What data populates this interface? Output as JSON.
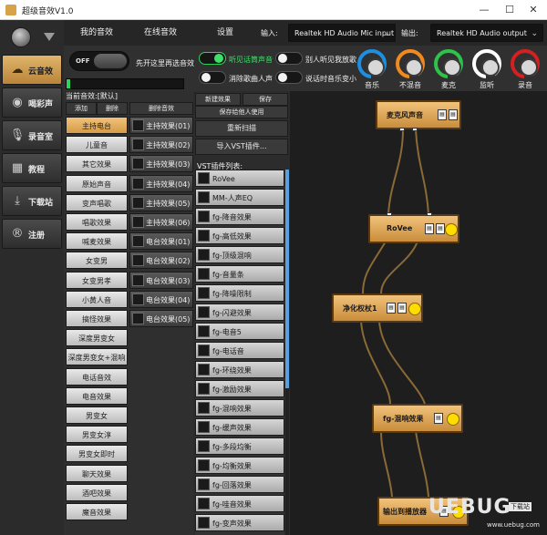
{
  "titlebar": {
    "title": "超级音效V1.0",
    "min": "—",
    "max": "☐",
    "close": "✕"
  },
  "nav": {
    "items": [
      {
        "label": "云音效",
        "icon": "☁",
        "active": true
      },
      {
        "label": "喝彩声",
        "icon": "◉",
        "active": false
      },
      {
        "label": "录音室",
        "icon": "🎙",
        "active": false
      },
      {
        "label": "教程",
        "icon": "▦",
        "active": false
      },
      {
        "label": "下载站",
        "icon": "⤓",
        "active": false
      },
      {
        "label": "注册",
        "icon": "®",
        "active": false
      }
    ]
  },
  "tabs": [
    "我的音效",
    "在线音效",
    "设置"
  ],
  "devices": {
    "input_label": "输入:",
    "input_value": "Realtek HD Audio Mic input",
    "output_label": "输出:",
    "output_value": "Realtek HD Audio output"
  },
  "options": {
    "power_label": "OFF",
    "hint": "先开这里再选音效",
    "toggles": [
      {
        "label": "听见话筒声音",
        "on": true
      },
      {
        "label": "别人听见我放歌",
        "on": false
      },
      {
        "label": "消除歌曲人声",
        "on": false
      },
      {
        "label": "说话时音乐变小",
        "on": false
      }
    ],
    "knobs": [
      {
        "label": "音乐",
        "color": "#1e8fe0"
      },
      {
        "label": "不混音",
        "color": "#f08a1e"
      },
      {
        "label": "麦克",
        "color": "#2ec24a"
      },
      {
        "label": "监听",
        "color": "#ffffff"
      },
      {
        "label": "录音",
        "color": "#d42020"
      }
    ],
    "level": 0.03
  },
  "presets": {
    "header": "当前音效:[默认]",
    "add": "添加",
    "delete": "删除",
    "delete_effect": "删除音效",
    "items": [
      "主持电台",
      "儿童音",
      "其它效果",
      "原始声音",
      "变声唱歌",
      "唱歌效果",
      "喊麦效果",
      "女变男",
      "女变男孝",
      "小黄人音",
      "搞怪效果",
      "深度男变女",
      "深度男变女+混响",
      "电话音效",
      "电音效果",
      "男变女",
      "男变女淳",
      "男变女即时",
      "聊天效果",
      "酒吧效果",
      "魔音效果"
    ],
    "selected": 0
  },
  "effects": {
    "items": [
      "主持效果(01)",
      "主持效果(02)",
      "主持效果(03)",
      "主持效果(04)",
      "主持效果(05)",
      "主持效果(06)",
      "电台效果(01)",
      "电台效果(02)",
      "电台效果(03)",
      "电台效果(04)",
      "电台效果(05)"
    ]
  },
  "vst": {
    "new_effect": "新建效果",
    "save": "保存",
    "save_for_others": "保存给他人使用",
    "rescan": "重新扫描",
    "import": "导入VST插件...",
    "list_label": "VST插件列表:",
    "items": [
      "RoVee",
      "MM-人声EQ",
      "fg-降音效果",
      "fg-高低效果",
      "fg-顶级混响",
      "fg-音量条",
      "fg-降噪限制",
      "fg-闪避效果",
      "fg-电音5",
      "fg-电话音",
      "fg-环绕效果",
      "fg-激励效果",
      "fg-混响效果",
      "fg-缓声效果",
      "fg-多段均衡",
      "fg-均衡效果",
      "fg-回落效果",
      "fg-哇音效果",
      "fg-变声效果"
    ]
  },
  "graph": {
    "nodes": [
      "麦克风声音",
      "RoVee",
      "净化权杖1",
      "fg-混响效果",
      "输出到播放器"
    ]
  },
  "watermark": {
    "text": "UEBUG",
    "tag": "下载站",
    "site": "www.uebug.com"
  }
}
